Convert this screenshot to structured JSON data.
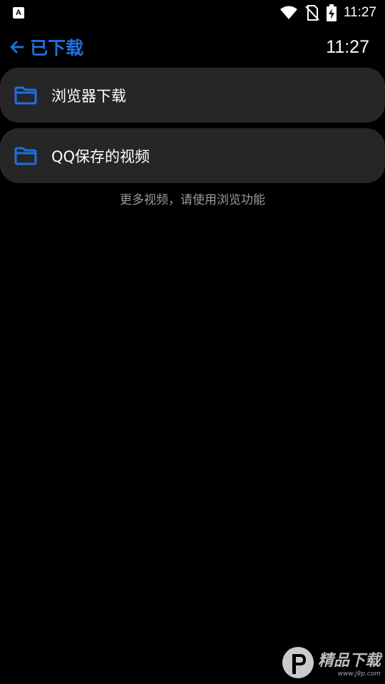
{
  "status_bar": {
    "notification_icon": "A",
    "time": "11:27",
    "icons": [
      "wifi-icon",
      "no-sim-icon",
      "battery-charging-icon"
    ]
  },
  "header": {
    "back_icon": "arrow-left-icon",
    "title": "已下载",
    "time": "11:27",
    "accent_color": "#1f6fe0"
  },
  "folders": [
    {
      "icon": "folder-icon",
      "label": "浏览器下载"
    },
    {
      "icon": "folder-icon",
      "label": "QQ保存的视频"
    }
  ],
  "hint": "更多视频，请使用浏览功能",
  "watermark": {
    "text": "精品下载",
    "url": "www.j9p.com"
  }
}
